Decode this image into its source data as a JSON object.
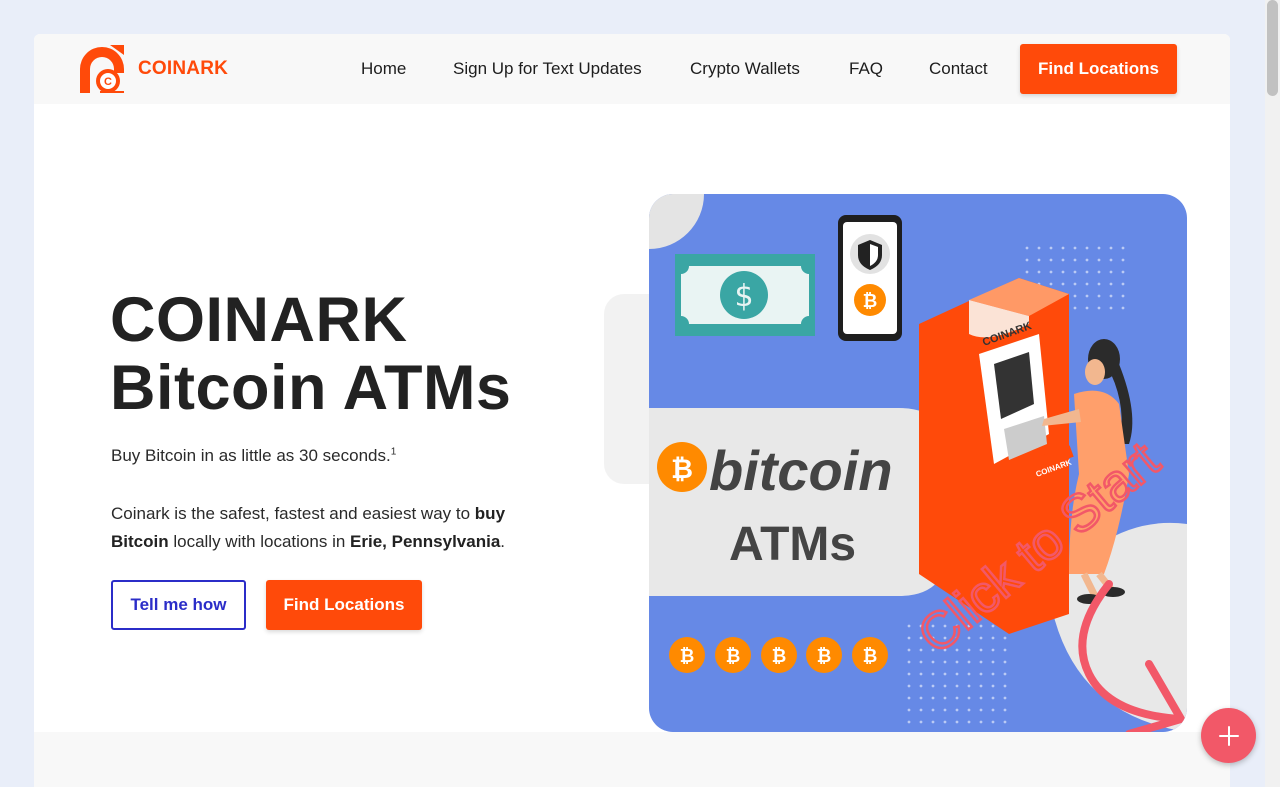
{
  "brand": {
    "name": "COINARK",
    "logo_icon": "coinark-c-logo"
  },
  "nav": {
    "items": [
      {
        "label": "Home"
      },
      {
        "label": "Sign Up for Text Updates"
      },
      {
        "label": "Crypto Wallets"
      },
      {
        "label": "FAQ"
      },
      {
        "label": "Contact"
      }
    ],
    "cta_label": "Find Locations"
  },
  "hero": {
    "title_line1": "COINARK",
    "title_line2": "Bitcoin ATMs",
    "subtitle": "Buy Bitcoin in as little as 30 seconds.",
    "subtitle_footnote": "1",
    "desc_part1": "Coinark is the safest, fastest and easiest way to ",
    "desc_bold1": "buy Bitcoin",
    "desc_part2": " locally with locations in ",
    "desc_bold2": "Erie, Pennsylvania",
    "desc_part3": ".",
    "btn_tell": "Tell me how",
    "btn_find": "Find Locations"
  },
  "illustration": {
    "word_bitcoin": "bitcoin",
    "word_atms": "ATMs",
    "atm_brand": "COINARK",
    "atm_sign": "COINARK",
    "overlay_text": "Click to Start",
    "currency_symbol": "$",
    "btc_symbol": "₿"
  },
  "fab": {
    "icon": "plus-icon"
  },
  "colors": {
    "accent": "#ff4a0a",
    "outline_blue": "#2b2dc8",
    "illustration_bg": "#6689e6",
    "fab": "#f25868"
  }
}
